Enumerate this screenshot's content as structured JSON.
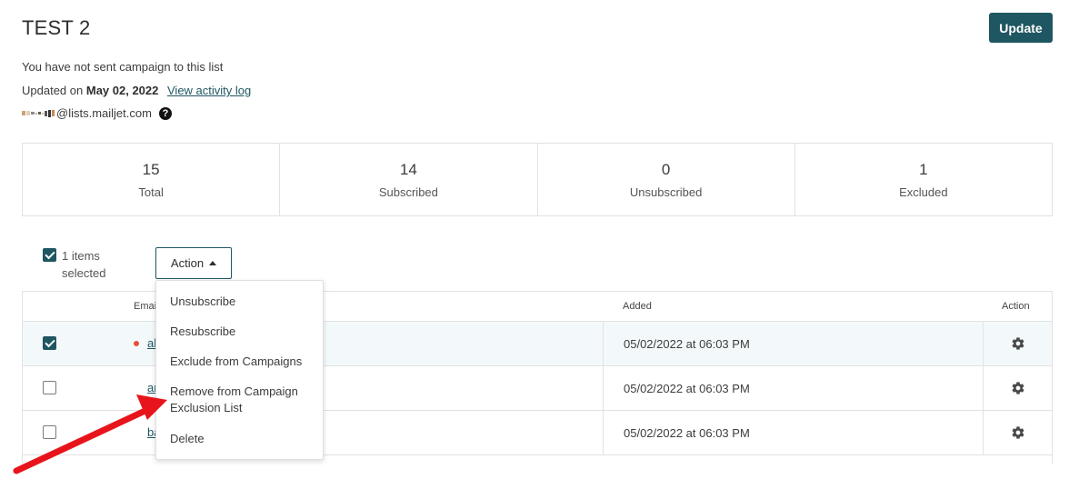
{
  "header": {
    "title": "TEST 2",
    "update_label": "Update"
  },
  "info": {
    "status_text": "You have not sent campaign to this list",
    "updated_prefix": "Updated on",
    "updated_date": "May 02, 2022",
    "activity_link": "View activity log",
    "email_domain": "@lists.mailjet.com",
    "help_icon": "?"
  },
  "stats": [
    {
      "value": "15",
      "label": "Total"
    },
    {
      "value": "14",
      "label": "Subscribed"
    },
    {
      "value": "0",
      "label": "Unsubscribed"
    },
    {
      "value": "1",
      "label": "Excluded"
    }
  ],
  "selection": {
    "text": "1 items selected",
    "action_label": "Action"
  },
  "table": {
    "headers": {
      "email": "Email",
      "added": "Added",
      "action": "Action"
    },
    "rows": [
      {
        "email": "al",
        "added": "05/02/2022 at 06:03 PM",
        "checked": true
      },
      {
        "email": "ar",
        "added": "05/02/2022 at 06:03 PM",
        "checked": false
      },
      {
        "email": "ba",
        "added": "05/02/2022 at 06:03 PM",
        "checked": false
      }
    ]
  },
  "dropdown": {
    "items": [
      "Unsubscribe",
      "Resubscribe",
      "Exclude from Campaigns",
      "Remove from Campaign Exclusion List",
      "Delete"
    ]
  },
  "colors": {
    "primary": "#1e5661",
    "excluded_dot": "#e8503a",
    "annotation_arrow": "#e8141b"
  },
  "icons": {
    "gear": "gear-icon",
    "caret": "caret-up-icon",
    "checkmark": "checkmark-icon",
    "help": "question-circle-icon"
  }
}
